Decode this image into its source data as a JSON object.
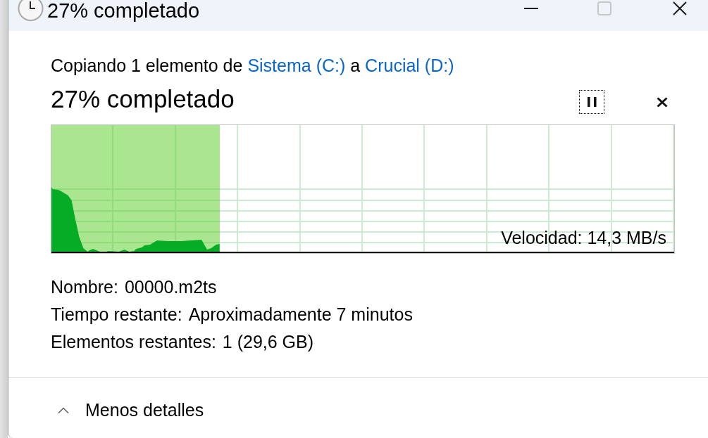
{
  "window": {
    "title": "27% completado",
    "controls": [
      {
        "kind": "minimize",
        "disabled": false
      },
      {
        "kind": "maximize",
        "disabled": true
      },
      {
        "kind": "close",
        "disabled": false
      }
    ]
  },
  "description": [
    {
      "kind": "text",
      "text": "Copiando 1 elemento de"
    },
    {
      "kind": "link",
      "text": "Sistema (C:)"
    },
    {
      "kind": "text",
      "text": "a"
    },
    {
      "kind": "link",
      "text": "Crucial (D:)"
    }
  ],
  "status": "27% completado",
  "pause_button": {
    "focused": true
  },
  "progress": {
    "level": 0.27,
    "speed": "Velocidad: 14,3 MB/s"
  },
  "details": [
    {
      "label": "Nombre:",
      "value": "00000.m2ts"
    },
    {
      "label": "Tiempo restante:",
      "value": "Aproximadamente 7 minutos"
    },
    {
      "label": "Elementos restantes:",
      "value": "1 (29,6 GB)"
    }
  ],
  "details_toggle": {
    "label": "Menos detalles",
    "expanded": true
  }
}
